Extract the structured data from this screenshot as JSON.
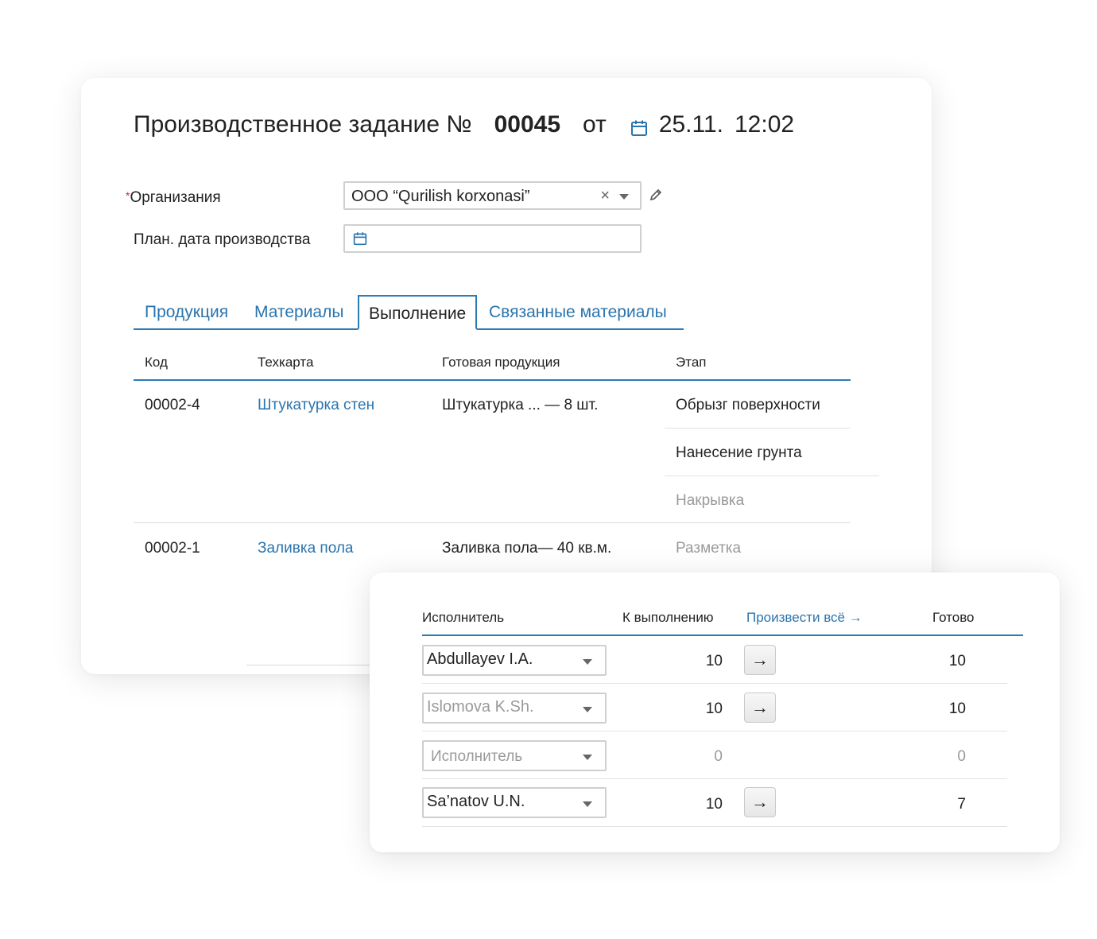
{
  "header": {
    "title": "Производственное задание №",
    "number": "00045",
    "from": "от",
    "date": "25.11.",
    "time": "12:02"
  },
  "form": {
    "org_label": "Организания",
    "org_required_mark": "*",
    "org_value": "ООО “Qurilish korxonasi”",
    "plan_date_label": "План. дата производства",
    "plan_date_value": ""
  },
  "tabs": [
    "Продукция",
    "Материалы",
    "Выполнение",
    "Связанные материалы"
  ],
  "active_tab": "Выполнение",
  "table": {
    "headers": [
      "Код",
      "Техкарта",
      "Готовая продукция",
      "Этап"
    ],
    "rows": [
      {
        "code": "00002-4",
        "techcard": "Штукатурка стен",
        "product": "Штукатурка ... — 8 шт.",
        "stages": [
          "Обрызг поверхности",
          "Нанесение грунта",
          "Накрывка"
        ]
      },
      {
        "code": "00002-1",
        "techcard": "Заливка пола",
        "product": "Заливка пола— 40 кв.м.",
        "stages": [
          "Разметка"
        ]
      }
    ]
  },
  "executors": {
    "headers": {
      "executor": "Исполнитель",
      "to_do": "К выполнению",
      "produce_all": "Произвести всё →",
      "done": "Готово"
    },
    "rows": [
      {
        "name": "Abdullayev I.A.",
        "to_do": "10",
        "done": "10",
        "arrow": "→"
      },
      {
        "name": "Islomova K.Sh.",
        "to_do": "10",
        "done": "10",
        "arrow": "→"
      },
      {
        "name": "Исполнитель",
        "to_do": "0",
        "done": "0"
      },
      {
        "name": "Sa’natov U.N.",
        "to_do": "10",
        "done": "7",
        "arrow": "→"
      }
    ]
  },
  "colors": {
    "accent": "#2d7bb5",
    "link": "#2a74ad",
    "required": "#dd2233",
    "muted": "#9a9a9a"
  },
  "icons": [
    "calendar-icon",
    "clear-icon",
    "chevron-down-icon",
    "edit-icon",
    "arrow-right-icon"
  ]
}
